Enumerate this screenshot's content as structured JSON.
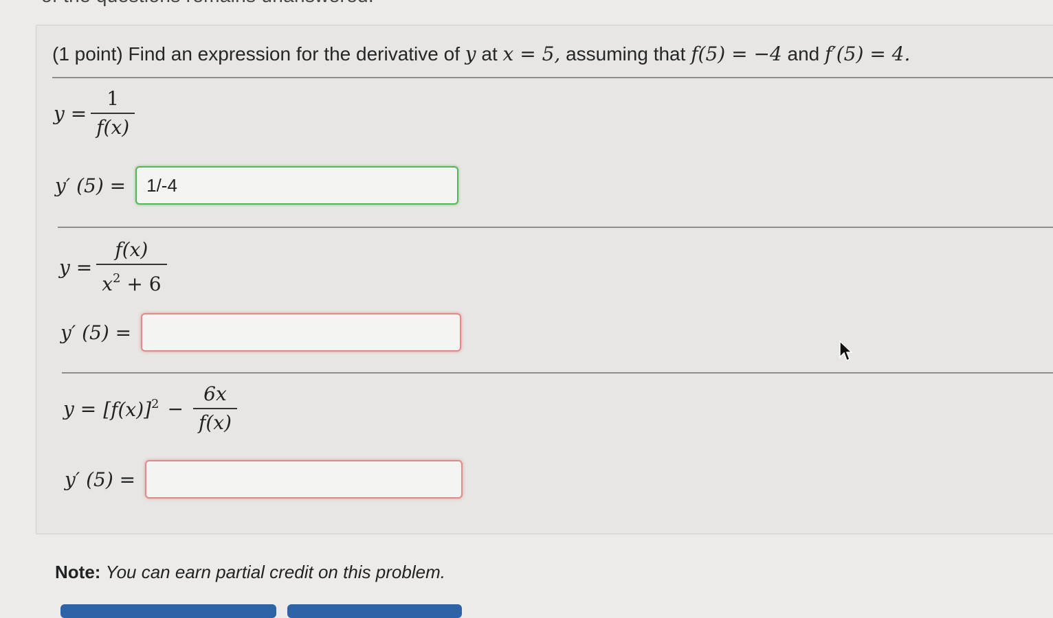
{
  "header": {
    "top_fragment": "of the questions remains unanswered."
  },
  "question": {
    "prefix": "(1 point) Find an expression for the derivative of",
    "var_y": "y",
    "at": "at",
    "x_eq": "x = 5,",
    "assuming": "assuming that",
    "f5": "f(5) = −4",
    "and": "and",
    "fp5": "f′(5) = 4."
  },
  "parts": [
    {
      "y_label": "y =",
      "numerator": "1",
      "denominator": "f(x)",
      "answer_label": "y′ (5) =",
      "answer_value": "1/-4",
      "status": "correct"
    },
    {
      "y_label": "y =",
      "numerator": "f(x)",
      "denominator_base": "x",
      "denominator_exp": "2",
      "denominator_rest": "+ 6",
      "answer_label": "y′ (5) =",
      "answer_value": "",
      "status": "incorrect"
    },
    {
      "y_label": "y =",
      "bracket_term": "[f(x)]",
      "bracket_exp": "2",
      "minus": "−",
      "numerator": "6x",
      "denominator": "f(x)",
      "answer_label": "y′ (5) =",
      "answer_value": "",
      "status": "incorrect"
    }
  ],
  "note": {
    "label": "Note:",
    "text": "You can earn partial credit on this problem."
  },
  "colors": {
    "correct_border": "#58b45a",
    "incorrect_border": "#e28a8a",
    "button": "#2f63a8"
  },
  "icons": {
    "cursor": "mouse-pointer-icon"
  }
}
